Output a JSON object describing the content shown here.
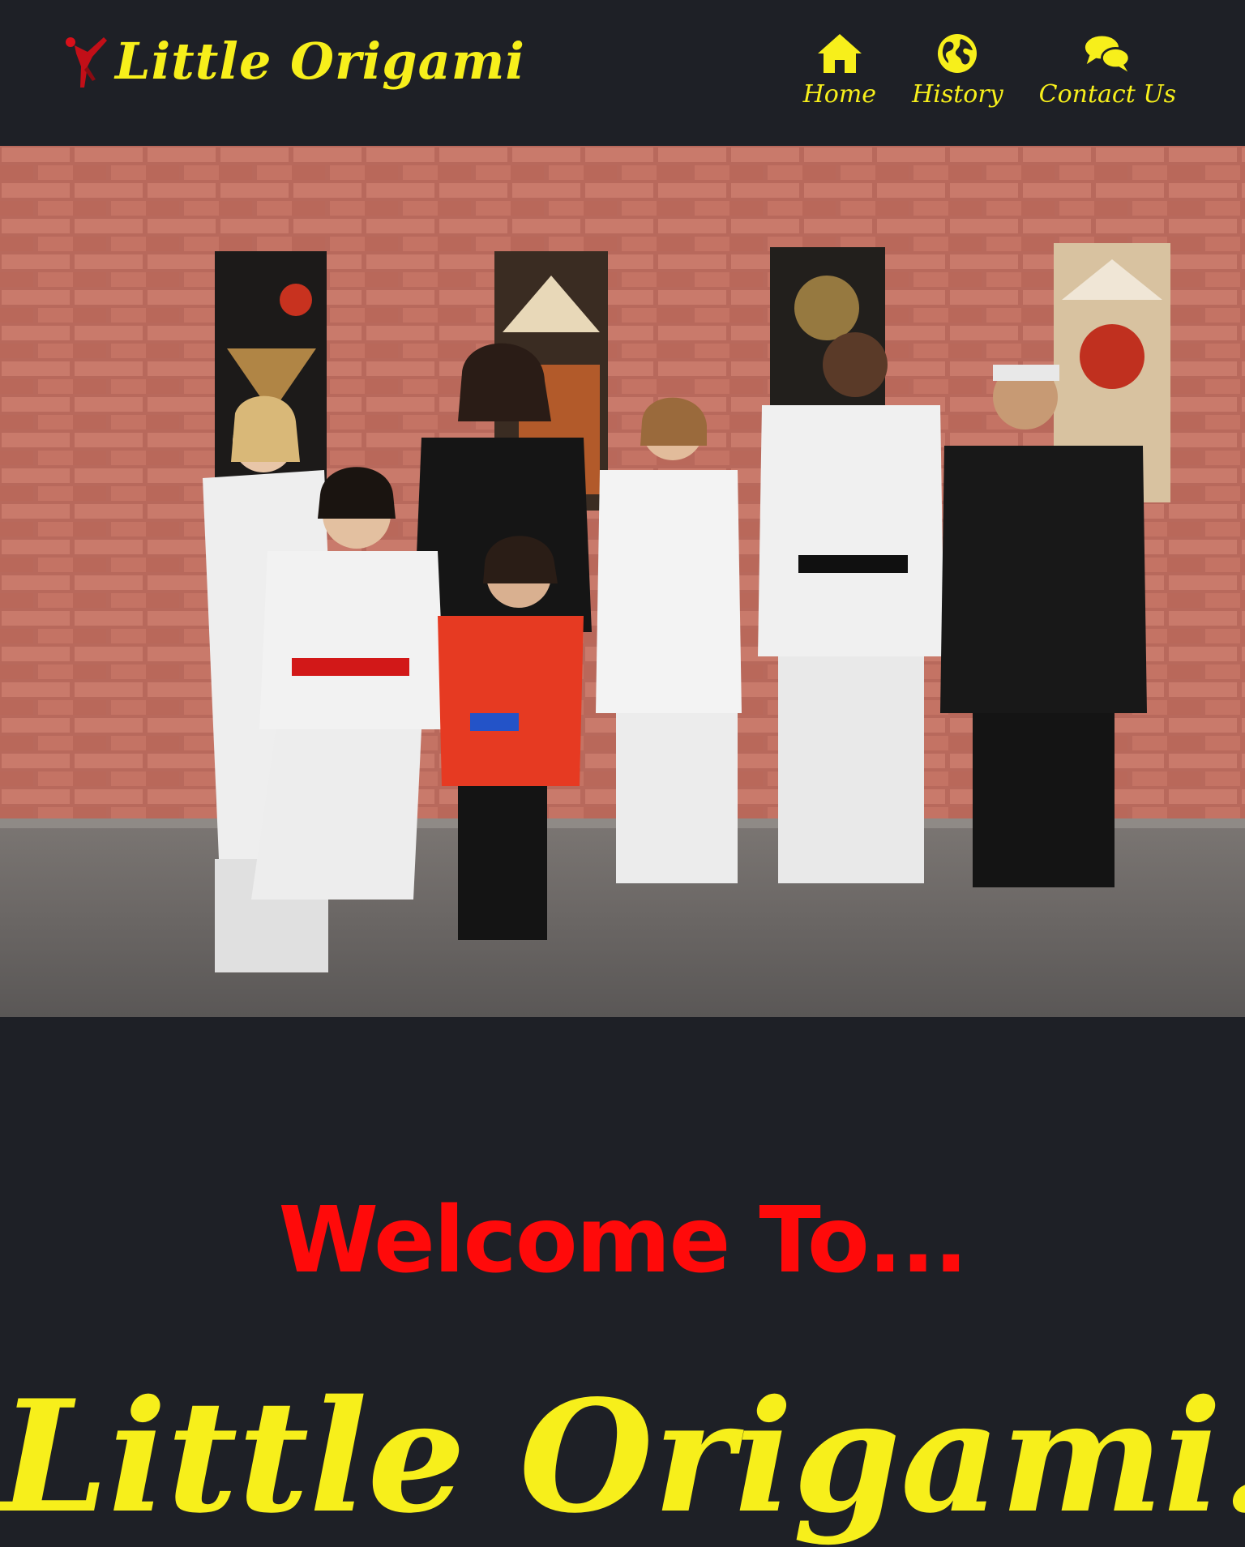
{
  "brand": {
    "name": "Little Origami",
    "logo_icon": "karate-kick-icon"
  },
  "nav": {
    "items": [
      {
        "label": "Home",
        "icon": "home-icon"
      },
      {
        "label": "History",
        "icon": "globe-icon"
      },
      {
        "label": "Contact Us",
        "icon": "chat-bubbles-icon"
      }
    ]
  },
  "hero": {
    "image": "group-photo-martial-arts-students-brick-wall",
    "carousel": {
      "count": 3,
      "active_index": 0
    }
  },
  "welcome": {
    "heading": "Welcome To...",
    "title": "Little Origami!"
  },
  "colors": {
    "background": "#1e2026",
    "accent_yellow": "#f7ef1b",
    "accent_red": "#ff0a0a"
  }
}
